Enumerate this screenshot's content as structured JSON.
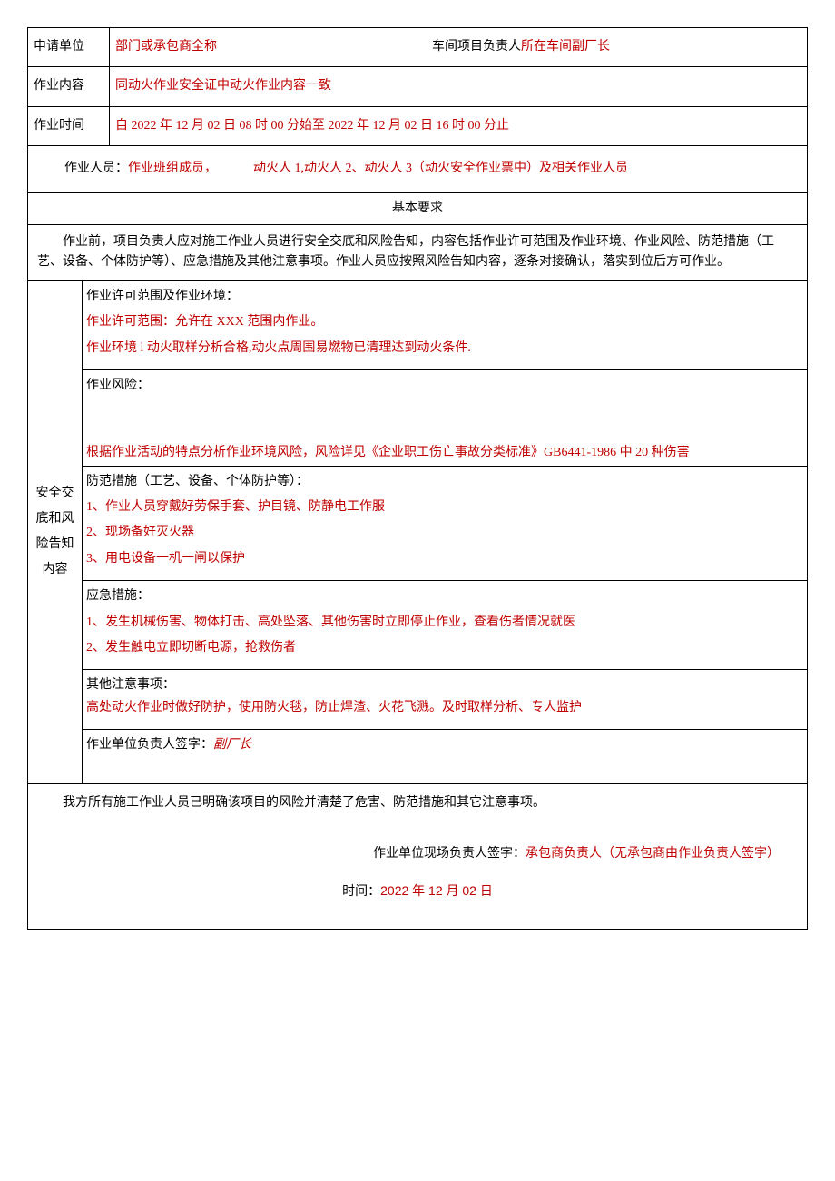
{
  "header": {
    "apply_unit_label": "申请单位",
    "apply_unit_value": "部门或承包商全称",
    "project_leader_label": "车间项目负责人",
    "project_leader_value": "所在车间副厂长",
    "work_content_label": "作业内容",
    "work_content_value": "同动火作业安全证中动火作业内容一致",
    "work_time_label": "作业时间",
    "work_time_value": "自 2022 年 12 月 02 日 08 时 00 分始至 2022 年 12 月 02 日 16 时 00 分止",
    "personnel_label": "作业人员：",
    "personnel_part1": "作业班组成员，",
    "personnel_part2": "动火人 1,动火人 2、动火人 3（动火安全作业票中）及相关作业人员"
  },
  "section_title": "基本要求",
  "requirement_para": "作业前，项目负责人应对施工作业人员进行安全交底和风险告知，内容包括作业许可范围及作业环境、作业风险、防范措施（工艺、设备、个体防护等）、应急措施及其他注意事项。作业人员应按照风险告知内容，逐条对接确认，落实到位后方可作业。",
  "safety": {
    "side_label_1": "安全交",
    "side_label_2": "底和风",
    "side_label_3": "险告知",
    "side_label_4": "内容",
    "scope": {
      "title": "作业许可范围及作业环境：",
      "line1": "作业许可范围：允许在 XXX 范围内作业。",
      "line2": "作业环境 l 动火取样分析合格,动火点周围易燃物已清理达到动火条件."
    },
    "risk": {
      "title": "作业风险：",
      "line1": "根据作业活动的特点分析作业环境风险，风险详见《企业职工伤亡事故分类标准》GB6441-1986 中 20 种伤害"
    },
    "prevent": {
      "title": "防范措施（工艺、设备、个体防护等）：",
      "item1": "1、作业人员穿戴好劳保手套、护目镜、防静电工作服",
      "item2": "2、现场备好灭火器",
      "item3": "3、用电设备一机一闸以保护"
    },
    "emergency": {
      "title": "应急措施：",
      "item1": "1、发生机械伤害、物体打击、高处坠落、其他伤害时立即停止作业，查看伤者情况就医",
      "item2": "2、发生触电立即切断电源，抢救伤者"
    },
    "other": {
      "title": "其他注意事项：",
      "line1": "高处动火作业时做好防护，使用防火毯，防止焊渣、火花飞溅。及时取样分析、专人监护"
    },
    "sign1": {
      "label": "作业单位负责人签字：",
      "value": "副厂长"
    }
  },
  "confirm": {
    "para": "我方所有施工作业人员已明确该项目的风险并清楚了危害、防范措施和其它注意事项。",
    "sign_label": "作业单位现场负责人签字：",
    "sign_value": "承包商负责人（无承包商由作业负责人签字）",
    "time_label": "时间：",
    "time_value": "2022 年 12 月 02 日"
  }
}
